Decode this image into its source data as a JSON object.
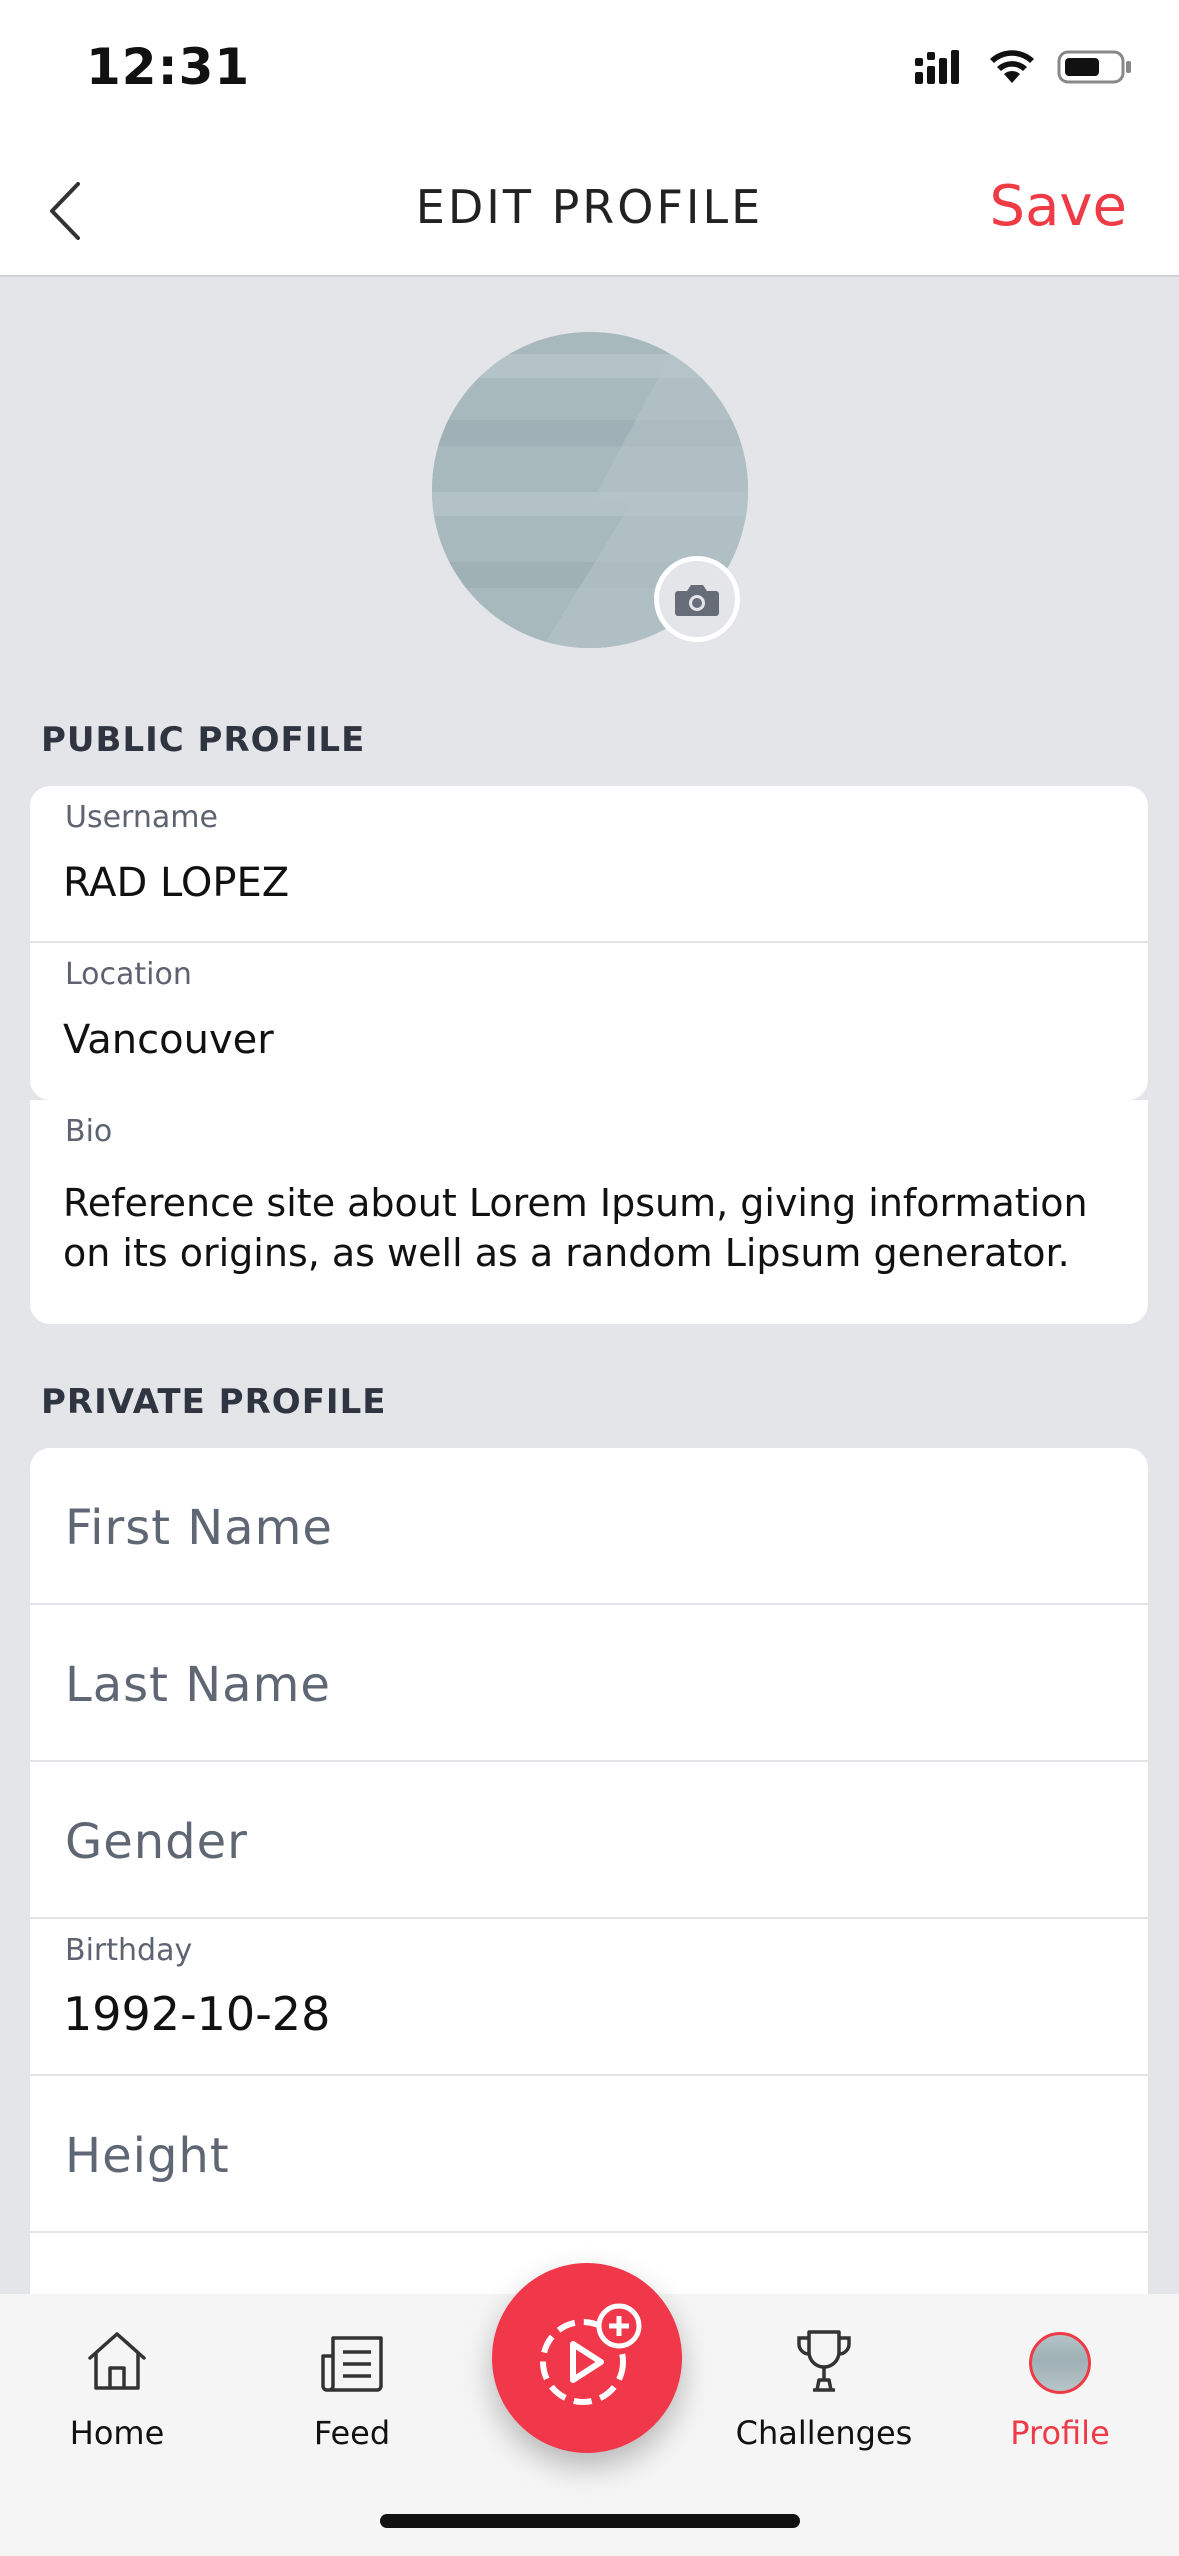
{
  "status_bar": {
    "time": "12:31"
  },
  "header": {
    "back_icon": "chevron-left-icon",
    "title": "EDIT PROFILE",
    "save_label": "Save",
    "accent_color": "#ee3b45"
  },
  "avatar": {
    "camera_icon": "camera-icon"
  },
  "public_profile": {
    "section_label": "PUBLIC PROFILE",
    "username": {
      "label": "Username",
      "value": "RAD LOPEZ"
    },
    "location": {
      "label": "Location",
      "value": "Vancouver"
    },
    "bio": {
      "label": "Bio",
      "value": "Reference site about Lorem Ipsum, giving information on its origins, as well as a random Lipsum generator."
    }
  },
  "private_profile": {
    "section_label": "PRIVATE PROFILE",
    "first_name": {
      "placeholder": "First Name"
    },
    "last_name": {
      "placeholder": "Last Name"
    },
    "gender": {
      "placeholder": "Gender"
    },
    "birthday": {
      "label": "Birthday",
      "value": "1992-10-28"
    },
    "height": {
      "placeholder": "Height"
    }
  },
  "tab_bar": {
    "active_color": "#ee3b45",
    "items": [
      {
        "label": "Home",
        "icon": "home-icon"
      },
      {
        "label": "Feed",
        "icon": "feed-icon"
      },
      {
        "label": "Challenges",
        "icon": "trophy-icon"
      },
      {
        "label": "Profile",
        "icon": "avatar"
      }
    ],
    "fab_icon": "create-video-icon"
  }
}
